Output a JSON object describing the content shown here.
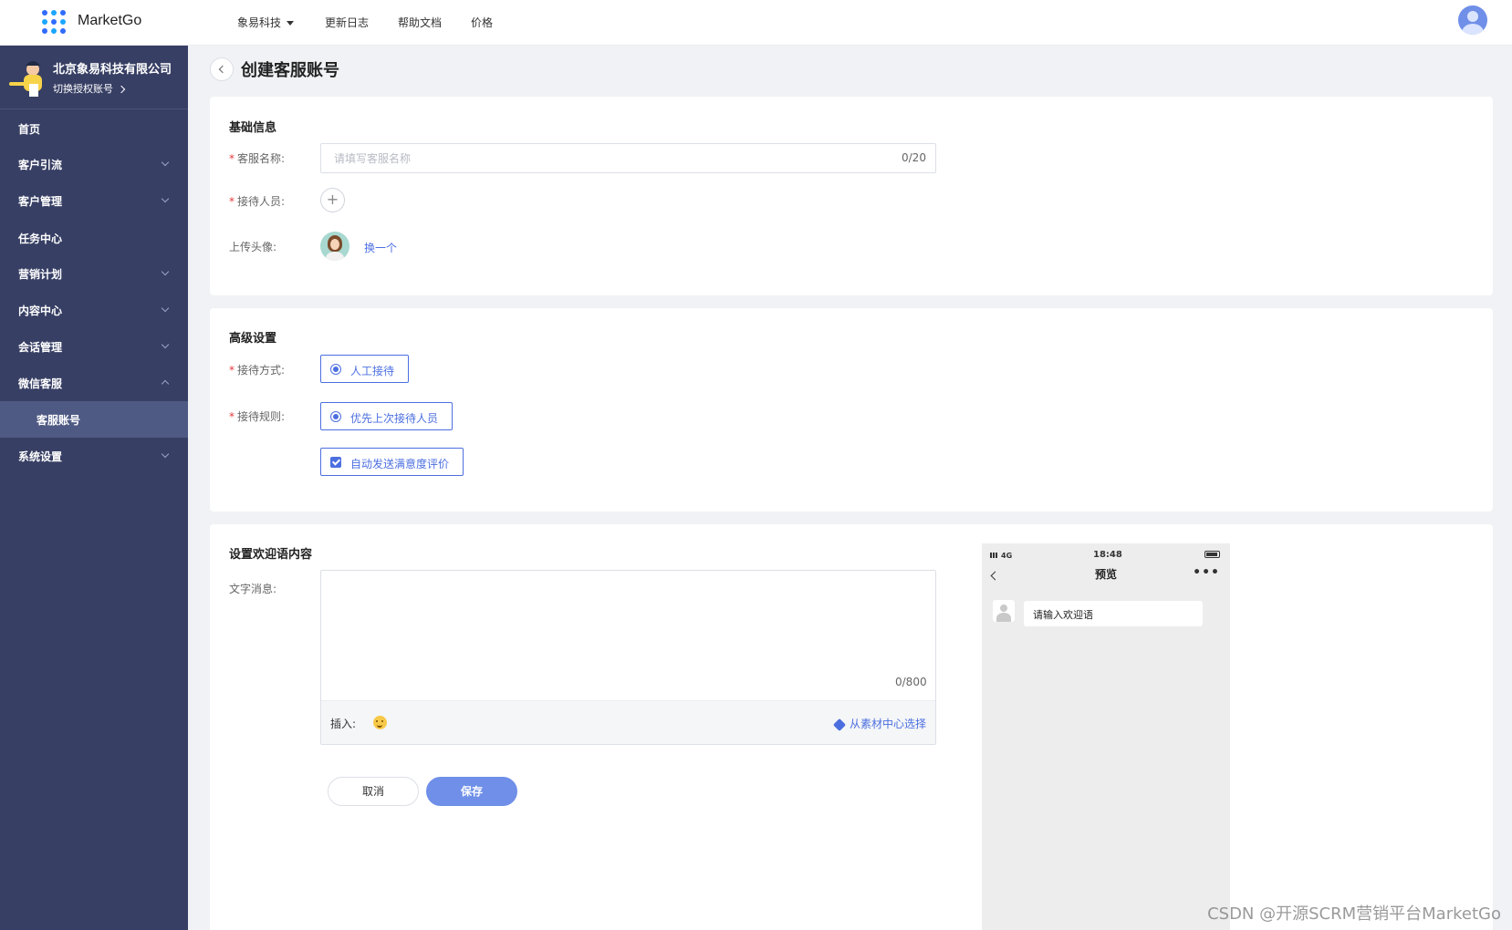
{
  "app": {
    "brand": "MarketGo"
  },
  "topnav": [
    "象易科技",
    "更新日志",
    "帮助文档",
    "价格"
  ],
  "org": {
    "name": "北京象易科技有限公司",
    "switch_label": "切换授权账号"
  },
  "sidebar": {
    "items": [
      {
        "label": "首页",
        "has_children": false
      },
      {
        "label": "客户引流",
        "has_children": true
      },
      {
        "label": "客户管理",
        "has_children": true
      },
      {
        "label": "任务中心",
        "has_children": false
      },
      {
        "label": "营销计划",
        "has_children": true
      },
      {
        "label": "内容中心",
        "has_children": true
      },
      {
        "label": "会话管理",
        "has_children": true
      },
      {
        "label": "微信客服",
        "has_children": true,
        "expanded": true
      },
      {
        "label": "客服账号",
        "active": true,
        "child": true
      },
      {
        "label": "系统设置",
        "has_children": true
      }
    ]
  },
  "page": {
    "title": "创建客服账号"
  },
  "basic": {
    "section_title": "基础信息",
    "name_label": "客服名称:",
    "name_placeholder": "请填写客服名称",
    "name_value": "",
    "name_counter": "0/20",
    "staff_label": "接待人员:",
    "avatar_label": "上传头像:",
    "change_avatar": "换一个"
  },
  "advanced": {
    "section_title": "高级设置",
    "mode_label": "接待方式:",
    "mode_option": "人工接待",
    "rule_label": "接待规则:",
    "rule_option": "优先上次接待人员",
    "auto_option": "自动发送满意度评价"
  },
  "welcome": {
    "section_title": "设置欢迎语内容",
    "text_label": "文字消息:",
    "text_value": "",
    "counter": "0/800",
    "insert_label": "插入:",
    "material_link": "从素材中心选择",
    "cancel": "取消",
    "save": "保存"
  },
  "preview": {
    "signal": "4G",
    "time": "18:48",
    "title": "预览",
    "bubble": "请输入欢迎语"
  },
  "watermark": "CSDN @开源SCRM营销平台MarketGo",
  "colors": {
    "sidebar": "#373f64",
    "accent": "#4c6fe0",
    "primary_button": "#6f8fe8",
    "required": "#e6393c"
  }
}
